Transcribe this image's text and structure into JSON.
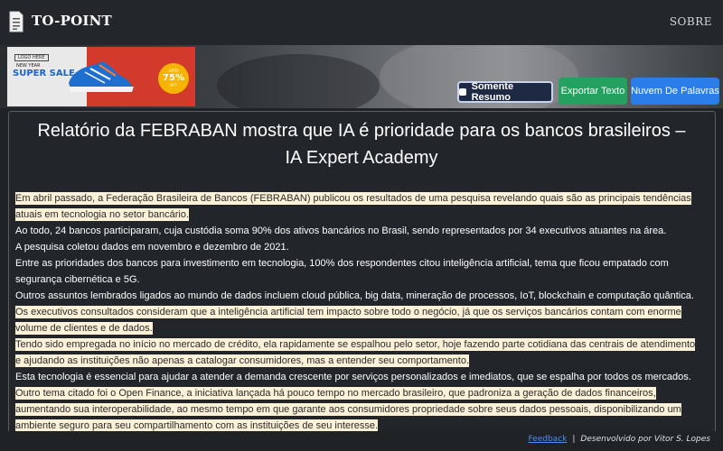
{
  "navbar": {
    "brand": "TO-POINT",
    "about_link": "SOBRE"
  },
  "ad": {
    "tag": "LOGO HERE",
    "subtitle": "NEW YEAR",
    "headline": "SUPER SALE",
    "badge_top": "UPTO",
    "badge_value": "75%",
    "badge_bottom": "OFF"
  },
  "actions": {
    "summary_toggle": "Somente Resumo",
    "export_text": "Exportar Texto",
    "word_cloud": "Nuvem De Palavras"
  },
  "article": {
    "title": "Relatório da FEBRABAN mostra que IA é prioridade para os bancos brasileiros – IA Expert Academy",
    "paragraphs": [
      {
        "text": "Em abril passado, a Federação Brasileira de Bancos (FEBRABAN) publicou os resultados de uma pesquisa revelando quais são as principais tendências atuais em tecnologia no setor bancário.",
        "highlighted": true
      },
      {
        "text": "Ao todo, 24 bancos participaram, cuja custódia soma 90% dos ativos bancários no Brasil, sendo representados por 34 executivos atuantes na área.",
        "highlighted": false
      },
      {
        "text": "A pesquisa coletou dados em novembro e dezembro de 2021.",
        "highlighted": false
      },
      {
        "text": "Entre as prioridades dos bancos para investimento em tecnologia, 100% dos respondentes citou inteligência artificial, tema que ficou empatado com segurança cibernética e 5G.",
        "highlighted": false
      },
      {
        "text": "Outros assuntos lembrados ligados ao mundo de dados incluem cloud pública, big data, mineração de processos, IoT, blockchain e computação quântica.",
        "highlighted": false
      },
      {
        "text": "Os executivos consultados consideram que a inteligência artificial tem impacto sobre todo o negócio, já que os serviços bancários contam com enorme volume de clientes e de dados.",
        "highlighted": true
      },
      {
        "text": "Tendo sido empregada no início no mercado de crédito, ela rapidamente se espalhou pelo setor, hoje fazendo parte cotidiana das centrais de atendimento e ajudando as instituições não apenas a catalogar consumidores, mas a entender seu comportamento.",
        "highlighted": true
      },
      {
        "text": "Esta tecnologia é essencial para ajudar a atender a demanda crescente por serviços personalizados e imediatos, que se espalha por todos os mercados.",
        "highlighted": false
      },
      {
        "text": "Outro tema citado foi o Open Finance, a iniciativa lançada há pouco tempo no mercado brasileiro, que padroniza a geração de dados financeiros, aumentando sua interoperabilidade, ao mesmo tempo em que garante aos consumidores propriedade sobre seus dados pessoais, disponibilizando um ambiente seguro para seu compartilhamento com as instituições de seu interesse.",
        "highlighted": true
      }
    ]
  },
  "footer": {
    "feedback": "Feedback",
    "separator": "|",
    "credit": "Desenvolvido por Vitor S. Lopes"
  },
  "colors": {
    "highlight": "#fdf1d8",
    "export_button": "#24a15f",
    "cloud_button": "#2b7de9",
    "summary_button": "#1e2a44"
  }
}
